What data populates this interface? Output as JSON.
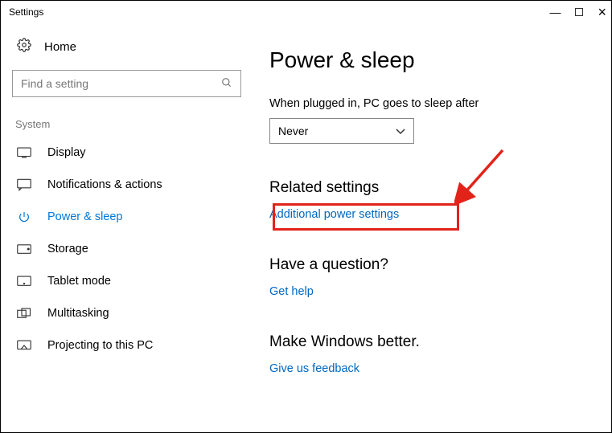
{
  "window": {
    "title": "Settings"
  },
  "sidebar": {
    "home_label": "Home",
    "search_placeholder": "Find a setting",
    "section_label": "System",
    "items": [
      {
        "label": "Display"
      },
      {
        "label": "Notifications & actions"
      },
      {
        "label": "Power & sleep"
      },
      {
        "label": "Storage"
      },
      {
        "label": "Tablet mode"
      },
      {
        "label": "Multitasking"
      },
      {
        "label": "Projecting to this PC"
      }
    ]
  },
  "main": {
    "heading": "Power & sleep",
    "sleep_label": "When plugged in, PC goes to sleep after",
    "sleep_value": "Never",
    "related_head": "Related settings",
    "related_link": "Additional power settings",
    "question_head": "Have a question?",
    "question_link": "Get help",
    "better_head": "Make Windows better.",
    "better_link": "Give us feedback"
  }
}
